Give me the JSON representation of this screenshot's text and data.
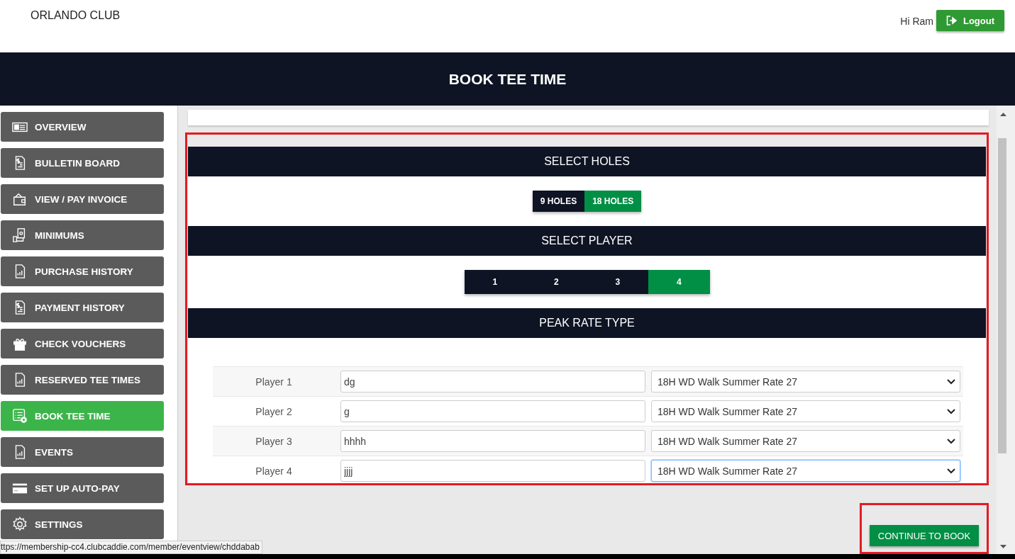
{
  "header": {
    "club_name": "ORLANDO CLUB",
    "greeting": "Hi Ram",
    "logout": "Logout"
  },
  "page_title": "BOOK TEE TIME",
  "sidebar": {
    "items": [
      {
        "label": "OVERVIEW",
        "selected": false
      },
      {
        "label": "BULLETIN BOARD",
        "selected": false
      },
      {
        "label": "VIEW / PAY INVOICE",
        "selected": false
      },
      {
        "label": "MINIMUMS",
        "selected": false
      },
      {
        "label": "PURCHASE HISTORY",
        "selected": false
      },
      {
        "label": "PAYMENT HISTORY",
        "selected": false
      },
      {
        "label": "CHECK VOUCHERS",
        "selected": false
      },
      {
        "label": "RESERVED TEE TIMES",
        "selected": false
      },
      {
        "label": "BOOK TEE TIME",
        "selected": true
      },
      {
        "label": "EVENTS",
        "selected": false
      },
      {
        "label": "SET UP AUTO-PAY",
        "selected": false
      },
      {
        "label": "SETTINGS",
        "selected": false
      }
    ]
  },
  "holes": {
    "title": "SELECT HOLES",
    "options": [
      {
        "label": "9 HOLES",
        "selected": false
      },
      {
        "label": "18 HOLES",
        "selected": true
      }
    ]
  },
  "players": {
    "title": "SELECT PLAYER",
    "options": [
      {
        "label": "1",
        "selected": false
      },
      {
        "label": "2",
        "selected": false
      },
      {
        "label": "3",
        "selected": false
      },
      {
        "label": "4",
        "selected": true
      }
    ]
  },
  "rates": {
    "title": "PEAK RATE TYPE",
    "rows": [
      {
        "label": "Player 1",
        "name": "dg",
        "rate": "18H WD Walk Summer Rate 27",
        "focused": false
      },
      {
        "label": "Player 2",
        "name": "g",
        "rate": "18H WD Walk Summer Rate 27",
        "focused": false
      },
      {
        "label": "Player 3",
        "name": "hhhh",
        "rate": "18H WD Walk Summer Rate 27",
        "focused": false
      },
      {
        "label": "Player 4",
        "name": "jjjj",
        "rate": "18H WD Walk Summer Rate 27",
        "focused": true
      }
    ]
  },
  "continue_button": "CONTINUE TO BOOK",
  "status_url": "ttps://membership-cc4.clubcaddie.com/member/eventview/chddabab"
}
